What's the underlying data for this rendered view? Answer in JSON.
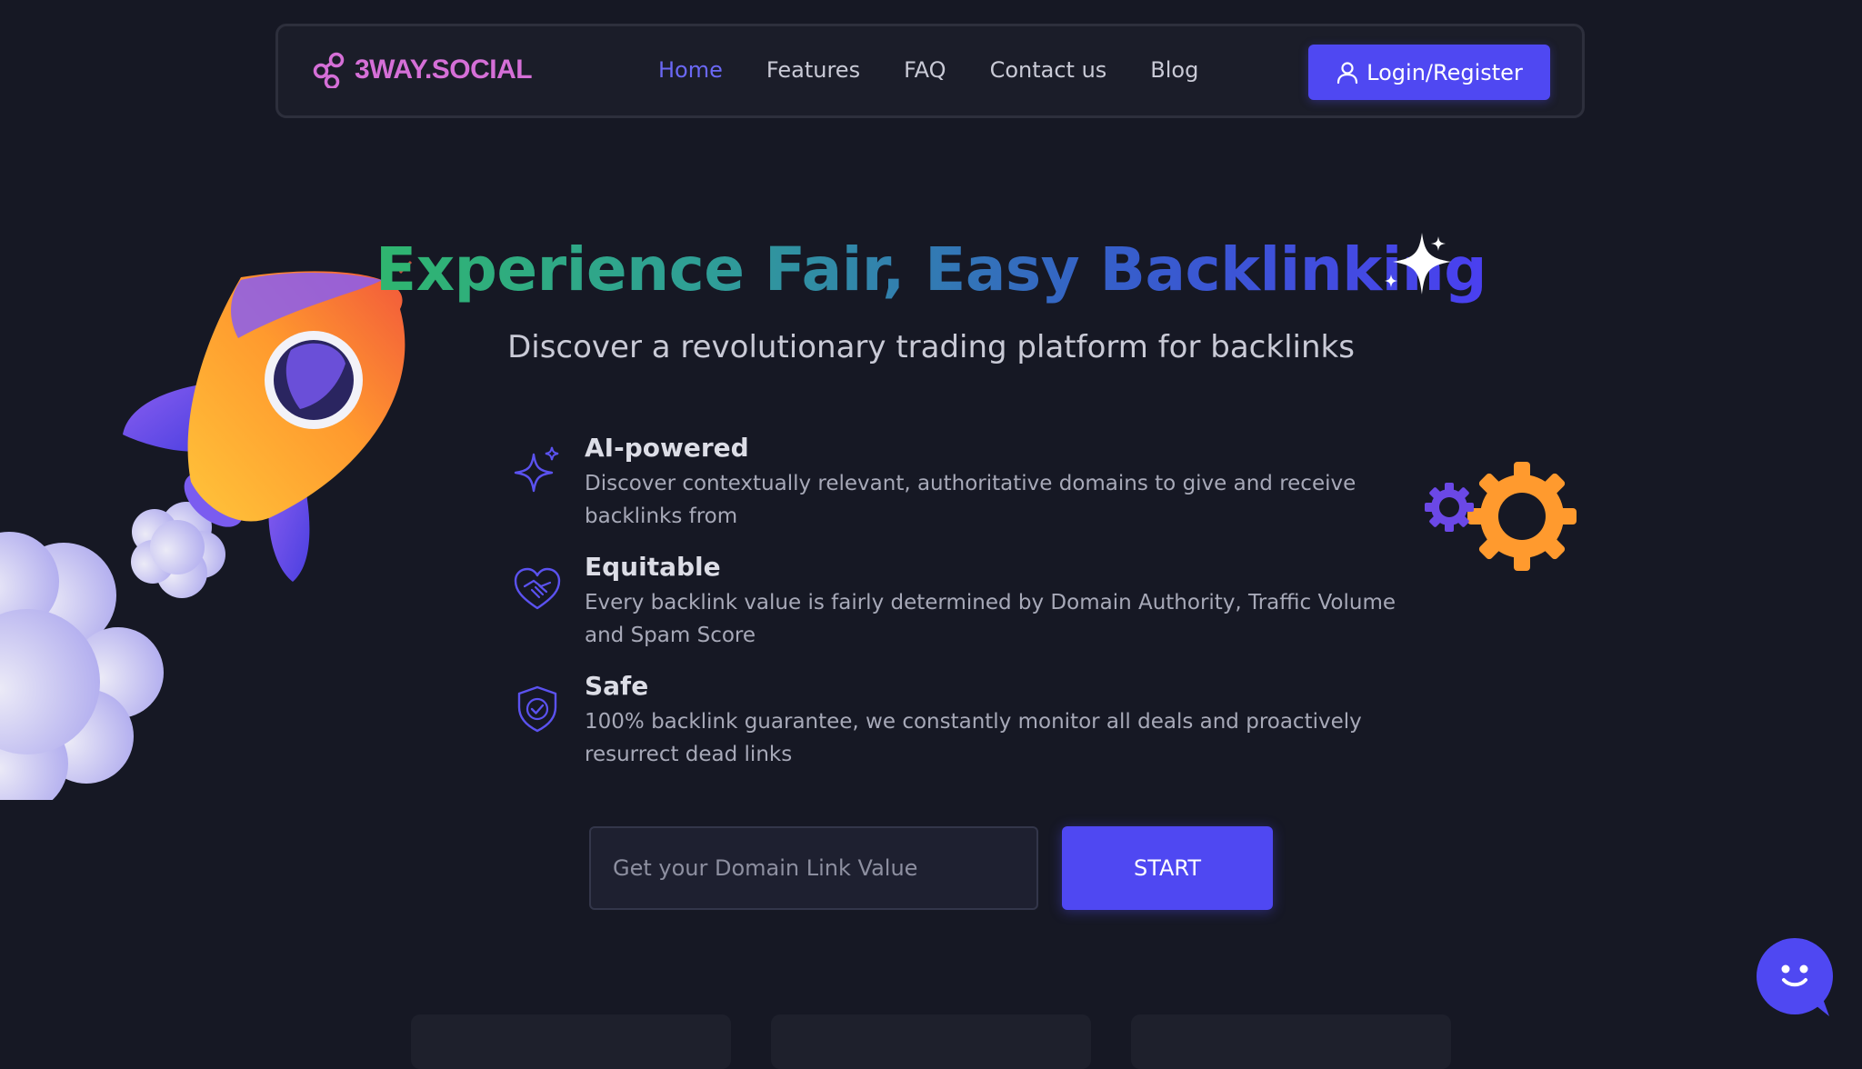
{
  "brand": {
    "name": "3WAY.SOCIAL",
    "accent": "#d56fd7"
  },
  "nav": {
    "items": [
      {
        "label": "Home",
        "active": true
      },
      {
        "label": "Features",
        "active": false
      },
      {
        "label": "FAQ",
        "active": false
      },
      {
        "label": "Contact us",
        "active": false
      },
      {
        "label": "Blog",
        "active": false
      }
    ],
    "login_label": "Login/Register"
  },
  "hero": {
    "title": "Experience Fair, Easy Backlinking",
    "subtitle": "Discover a revolutionary trading platform for backlinks"
  },
  "features": [
    {
      "icon": "sparkle-icon",
      "title": "AI-powered",
      "description": "Discover contextually relevant, authoritative domains to give and receive backlinks from"
    },
    {
      "icon": "heart-handshake-icon",
      "title": "Equitable",
      "description": "Every backlink value is fairly determined by Domain Authority, Traffic Volume and Spam Score"
    },
    {
      "icon": "shield-check-icon",
      "title": "Safe",
      "description": "100% backlink guarantee, we constantly monitor all deals and proactively resurrect dead links"
    }
  ],
  "cta": {
    "input_placeholder": "Get your Domain Link Value",
    "input_value": "",
    "button_label": "START"
  },
  "colors": {
    "background": "#161824",
    "primary": "#4f48f2",
    "nav_active": "#6b68f5"
  }
}
